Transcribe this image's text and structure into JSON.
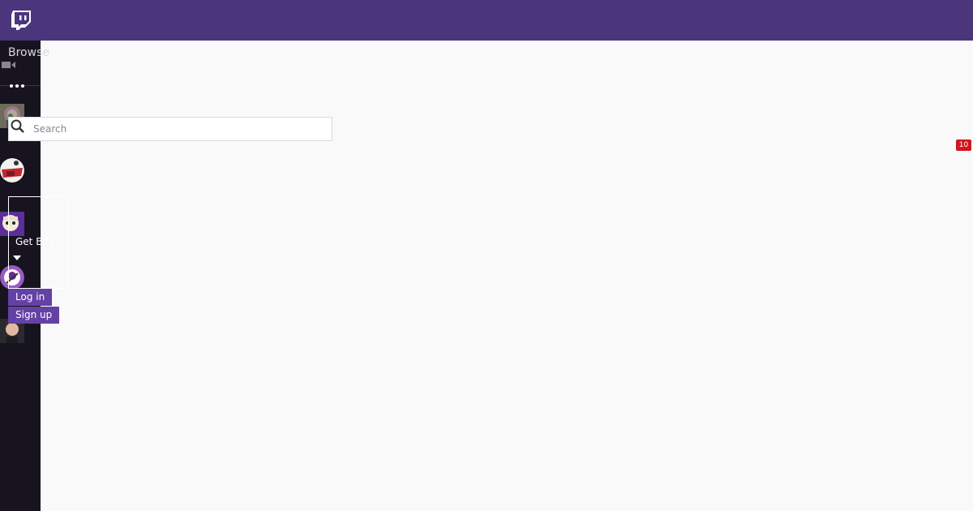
{
  "topbar": {
    "brand_color": "#4b367c",
    "logo_icon": "twitch-glitch-icon"
  },
  "sidebar": {
    "browse_label": "Browse",
    "icons": [
      "video-camera-icon",
      "more-dots-icon"
    ],
    "avatars": [
      "channel-avatar-1",
      "channel-avatar-2",
      "channel-avatar-3",
      "channel-avatar-4",
      "channel-avatar-5"
    ]
  },
  "search": {
    "placeholder": "Search",
    "value": ""
  },
  "notifications": {
    "count": "10",
    "badge_color": "#d0161f"
  },
  "bits": {
    "label": "Get Bits"
  },
  "auth": {
    "login_label": "Log in",
    "signup_label": "Sign up",
    "button_color": "#6441a4"
  }
}
